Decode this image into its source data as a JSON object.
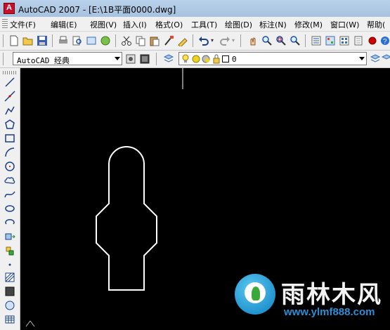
{
  "window": {
    "title": "AutoCAD 2007 - [E:\\1B平面0000.dwg]"
  },
  "menu": {
    "items": [
      "文件(F)",
      "编辑(E)",
      "视图(V)",
      "插入(I)",
      "格式(O)",
      "工具(T)",
      "绘图(D)",
      "标注(N)",
      "修改(M)",
      "窗口(W)",
      "帮助("
    ]
  },
  "workspace": {
    "selected": "AutoCAD 经典"
  },
  "layer": {
    "current": "0"
  },
  "watermark": {
    "name": "雨林木风",
    "url": "www.ylmf888.com"
  },
  "colors": {
    "canvas_background": "#000000",
    "drawing_stroke": "#ffffff",
    "ui_background": "#f0f0f0",
    "titlebar": "#b9d1ea",
    "watermark_url": "#2a8fd6"
  },
  "icons": {
    "standard_toolbar": [
      "new-icon",
      "open-icon",
      "save-icon",
      "print-icon",
      "preview-icon",
      "publish-icon",
      "3d-dwf-icon",
      "cut-icon",
      "copy-icon",
      "paste-icon",
      "match-properties-icon",
      "block-editor-icon",
      "undo-icon",
      "redo-icon",
      "pan-icon",
      "zoom-realtime-icon",
      "zoom-window-icon",
      "zoom-previous-icon",
      "properties-icon",
      "design-center-icon",
      "tool-palettes-icon",
      "sheet-set-icon"
    ],
    "draw_toolbar": [
      "line-icon",
      "construction-line-icon",
      "polyline-icon",
      "polygon-icon",
      "rectangle-icon",
      "arc-icon",
      "circle-icon",
      "revision-cloud-icon",
      "spline-icon",
      "ellipse-icon",
      "ellipse-arc-icon",
      "insert-block-icon",
      "make-block-icon",
      "point-icon",
      "hatch-icon",
      "gradient-icon",
      "region-icon",
      "table-icon"
    ]
  }
}
